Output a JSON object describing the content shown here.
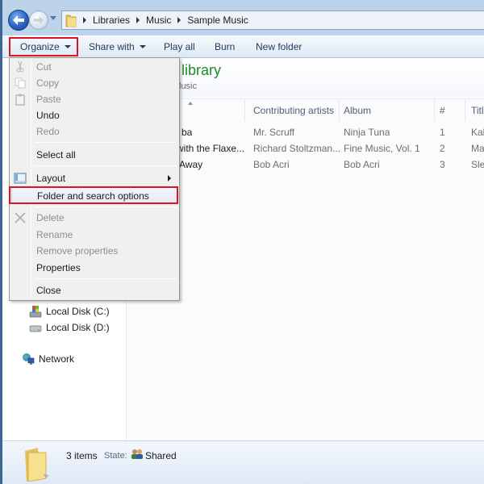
{
  "address_bar": {
    "breadcrumbs": [
      "Libraries",
      "Music",
      "Sample Music"
    ]
  },
  "toolbar": {
    "organize": "Organize",
    "share_with": "Share with",
    "play_all": "Play all",
    "burn": "Burn",
    "new_folder": "New folder"
  },
  "library": {
    "title": "library",
    "subtitle": "lusic"
  },
  "columns": [
    {
      "label": ""
    },
    {
      "label": "Contributing artists"
    },
    {
      "label": "Album"
    },
    {
      "label": "#"
    },
    {
      "label": "Titl"
    }
  ],
  "rows": [
    {
      "name": "ba",
      "artist": "Mr. Scruff",
      "album": "Ninja Tuna",
      "num": "1",
      "title": "Kal"
    },
    {
      "name": "with the Flaxe...",
      "artist": "Richard Stoltzman...",
      "album": "Fine Music, Vol. 1",
      "num": "2",
      "title": "Ma"
    },
    {
      "name": "Away",
      "artist": "Bob Acri",
      "album": "Bob Acri",
      "num": "3",
      "title": "Sle"
    }
  ],
  "nav_pane": {
    "local_c": "Local Disk (C:)",
    "local_d": "Local Disk (D:)",
    "network": "Network"
  },
  "organize_menu": {
    "items": [
      {
        "label": "Cut",
        "enabled": false,
        "icon": "scissors-icon"
      },
      {
        "label": "Copy",
        "enabled": false,
        "icon": "copy-icon"
      },
      {
        "label": "Paste",
        "enabled": false,
        "icon": "clipboard-icon"
      },
      {
        "label": "Undo",
        "enabled": true
      },
      {
        "label": "Redo",
        "enabled": false
      },
      {
        "label": "Select all",
        "enabled": true
      },
      {
        "label": "Layout",
        "enabled": true,
        "icon": "layout-icon",
        "submenu": true
      },
      {
        "label": "Folder and search options",
        "enabled": true,
        "highlighted": true
      },
      {
        "label": "Delete",
        "enabled": false,
        "icon": "delete-x-icon"
      },
      {
        "label": "Rename",
        "enabled": false
      },
      {
        "label": "Remove properties",
        "enabled": false
      },
      {
        "label": "Properties",
        "enabled": true
      },
      {
        "label": "Close",
        "enabled": true
      }
    ]
  },
  "status_bar": {
    "count": "3 items",
    "state_label": "State:",
    "state_value": "Shared"
  },
  "colors": {
    "highlight_box": "#e0141e",
    "library_title": "#1e8a2a"
  }
}
